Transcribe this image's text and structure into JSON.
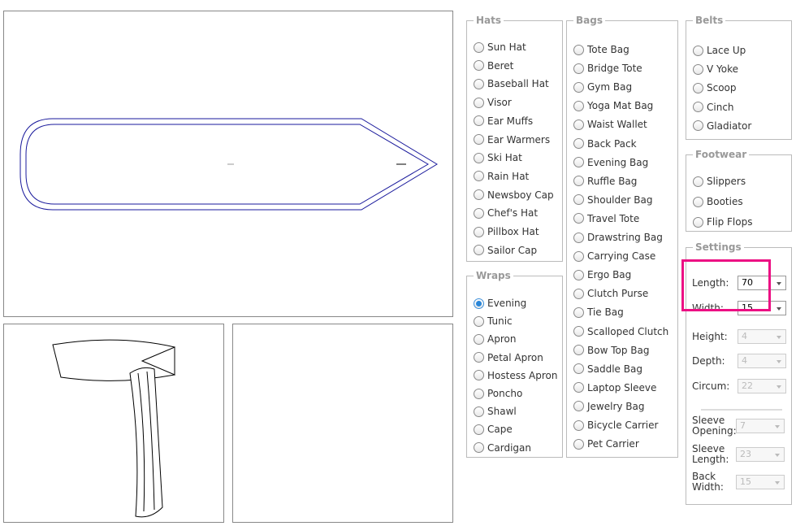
{
  "groups": [
    {
      "id": "hats",
      "legend": "Hats",
      "items": [
        "Sun Hat",
        "Beret",
        "Baseball Hat",
        "Visor",
        "Ear Muffs",
        "Ear Warmers",
        "Ski Hat",
        "Rain Hat",
        "Newsboy Cap",
        "Chef's Hat",
        "Pillbox Hat",
        "Sailor Cap"
      ]
    },
    {
      "id": "wraps",
      "legend": "Wraps",
      "items": [
        "Evening",
        "Tunic",
        "Apron",
        "Petal Apron",
        "Hostess Apron",
        "Poncho",
        "Shawl",
        "Cape",
        "Cardigan"
      ],
      "selected": "Evening"
    },
    {
      "id": "bags",
      "legend": "Bags",
      "items": [
        "Tote Bag",
        "Bridge Tote",
        "Gym Bag",
        "Yoga Mat Bag",
        "Waist Wallet",
        "Back Pack",
        "Evening Bag",
        "Ruffle Bag",
        "Shoulder Bag",
        "Travel Tote",
        "Drawstring Bag",
        "Carrying Case",
        "Ergo Bag",
        "Clutch Purse",
        "Tie Bag",
        "Scalloped Clutch",
        "Bow Top Bag",
        "Saddle Bag",
        "Laptop Sleeve",
        "Jewelry Bag",
        "Bicycle Carrier",
        "Pet Carrier"
      ]
    },
    {
      "id": "belts",
      "legend": "Belts",
      "items": [
        "Lace Up",
        "V Yoke",
        "Scoop",
        "Cinch",
        "Gladiator"
      ]
    },
    {
      "id": "footwear",
      "legend": "Footwear",
      "items": [
        "Slippers",
        "Booties",
        "Flip Flops"
      ]
    }
  ],
  "settings": {
    "legend": "Settings",
    "fields": [
      {
        "label": "Length:",
        "value": "70",
        "enabled": true
      },
      {
        "label": "Width:",
        "value": "15",
        "enabled": true
      },
      {
        "label": "Height:",
        "value": "4",
        "enabled": false
      },
      {
        "label": "Depth:",
        "value": "4",
        "enabled": false
      },
      {
        "label": "Circum:",
        "value": "22",
        "enabled": false
      },
      {
        "label": "Sleeve Opening:",
        "value": "7",
        "enabled": false
      },
      {
        "label": "Sleeve Length:",
        "value": "23",
        "enabled": false
      },
      {
        "label": "Back Width:",
        "value": "15",
        "enabled": false
      }
    ]
  },
  "colors": {
    "highlight": "#ec0f83",
    "pattern_outline": "#1a1a9c",
    "selected_radio": "#2a86d8"
  }
}
